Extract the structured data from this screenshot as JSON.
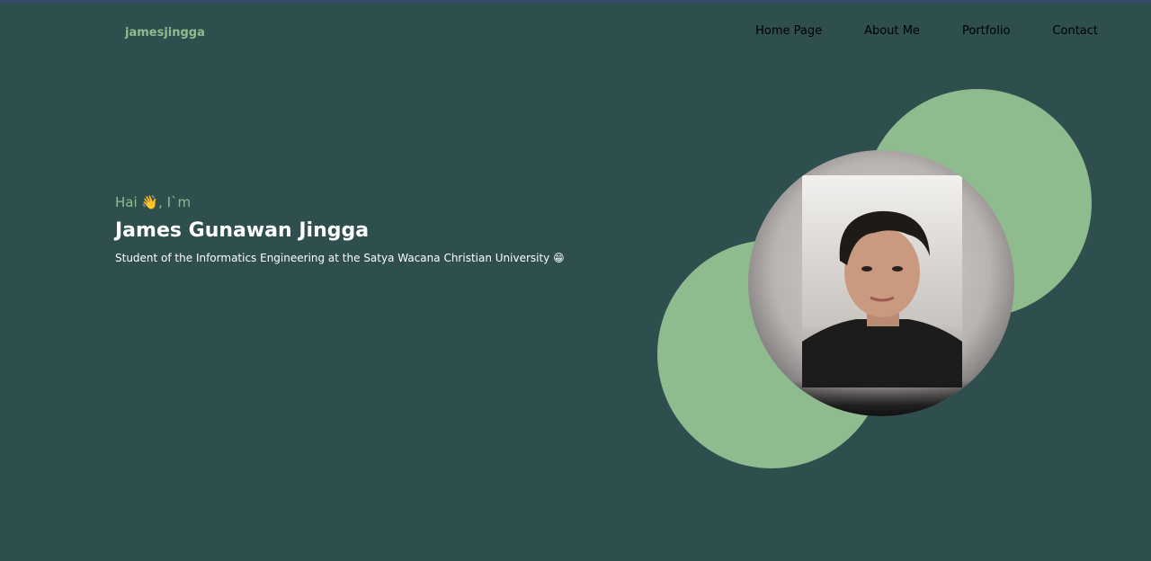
{
  "nav": {
    "brand": "jamesjingga",
    "links": [
      {
        "label": "Home Page"
      },
      {
        "label": "About Me"
      },
      {
        "label": "Portfolio"
      },
      {
        "label": "Contact"
      }
    ]
  },
  "hero": {
    "greeting": "Hai 👋, I`m",
    "name": "James Gunawan Jingga",
    "tagline": "Student of the Informatics Engineering at the Satya Wacana Christian University 😁"
  },
  "colors": {
    "background": "#2f4f4f",
    "accent": "#8fbc8f",
    "text": "#ffffff",
    "nav_text": "#000000"
  },
  "profile_photo": {
    "icon": "profile-photo"
  }
}
